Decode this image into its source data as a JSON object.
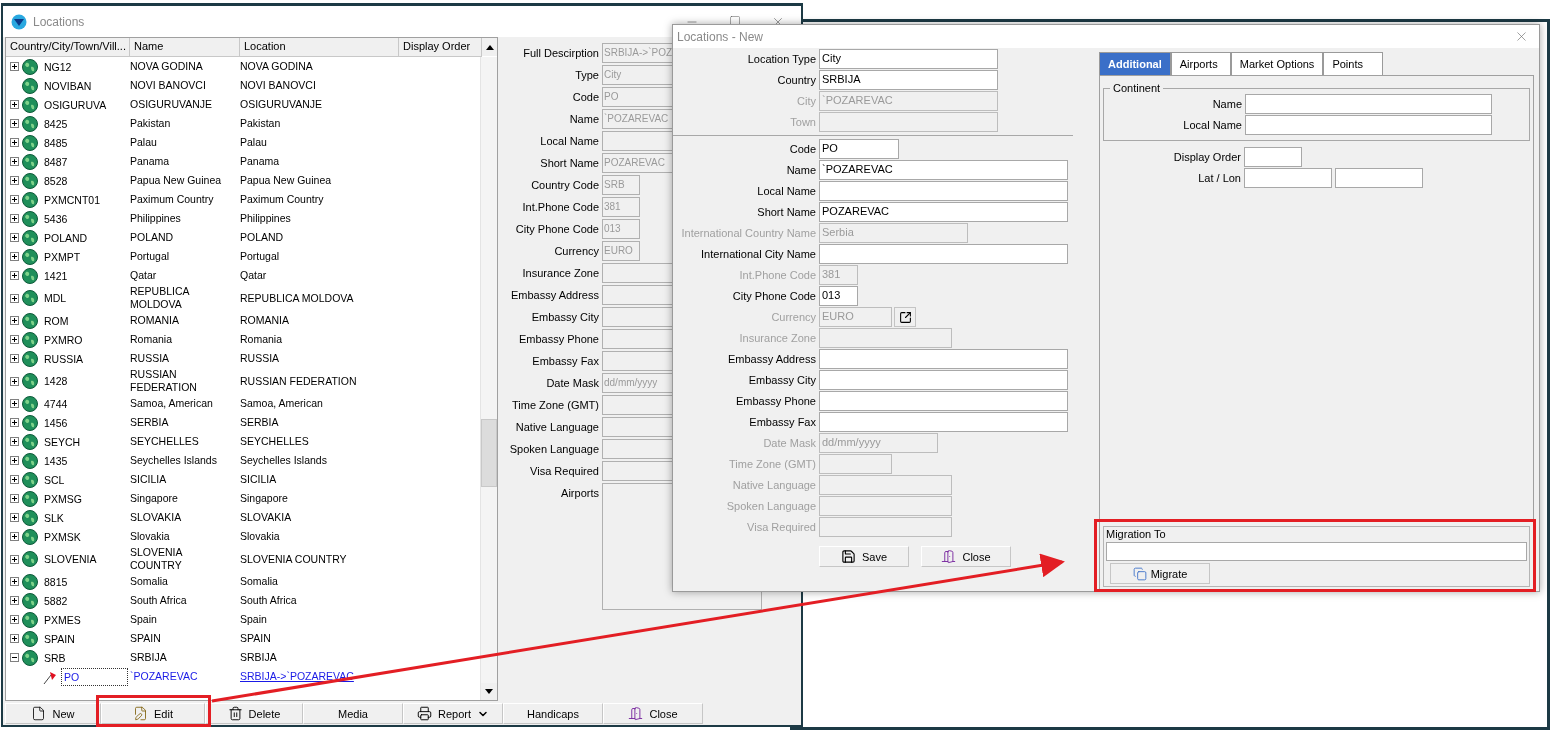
{
  "main_window": {
    "title": "Locations",
    "tree": {
      "columns": [
        "Country/City/Town/Vill...",
        "Name",
        "Location",
        "Display Order"
      ],
      "rows": [
        {
          "kind": "country",
          "code": "NG12",
          "name": "NOVA GODINA",
          "location": "NOVA GODINA",
          "expanded": false,
          "selected": false
        },
        {
          "kind": "country",
          "code": "NOVIBAN",
          "name": "NOVI BANOVCI",
          "location": "NOVI BANOVCI",
          "selected": false
        },
        {
          "kind": "country",
          "code": "OSIGURUVA",
          "name": "OSIGURUVANJE",
          "location": "OSIGURUVANJE",
          "expanded": false,
          "selected": false
        },
        {
          "kind": "country",
          "code": "8425",
          "name": "Pakistan",
          "location": "Pakistan",
          "expanded": false,
          "selected": false
        },
        {
          "kind": "country",
          "code": "8485",
          "name": "Palau",
          "location": "Palau",
          "expanded": false,
          "selected": false
        },
        {
          "kind": "country",
          "code": "8487",
          "name": "Panama",
          "location": "Panama",
          "expanded": false,
          "selected": false
        },
        {
          "kind": "country",
          "code": "8528",
          "name": "Papua New Guinea",
          "location": "Papua New Guinea",
          "expanded": false,
          "selected": false
        },
        {
          "kind": "country",
          "code": "PXMCNT01",
          "name": "Paximum Country",
          "location": "Paximum Country",
          "expanded": false,
          "selected": false
        },
        {
          "kind": "country",
          "code": "5436",
          "name": "Philippines",
          "location": "Philippines",
          "expanded": false,
          "selected": false
        },
        {
          "kind": "country",
          "code": "POLAND",
          "name": "POLAND",
          "location": "POLAND",
          "expanded": false,
          "selected": false
        },
        {
          "kind": "country",
          "code": "PXMPT",
          "name": "Portugal",
          "location": "Portugal",
          "expanded": false,
          "selected": false
        },
        {
          "kind": "country",
          "code": "1421",
          "name": "Qatar",
          "location": "Qatar",
          "expanded": false,
          "selected": false
        },
        {
          "kind": "country",
          "code": "MDL",
          "name": "REPUBLICA MOLDOVA",
          "location": "REPUBLICA MOLDOVA",
          "expanded": false,
          "selected": false
        },
        {
          "kind": "country",
          "code": "ROM",
          "name": "ROMANIA",
          "location": "ROMANIA",
          "expanded": false,
          "selected": false
        },
        {
          "kind": "country",
          "code": "PXMRO",
          "name": "Romania",
          "location": "Romania",
          "expanded": false,
          "selected": false
        },
        {
          "kind": "country",
          "code": "RUSSIA",
          "name": "RUSSIA",
          "location": "RUSSIA",
          "expanded": false,
          "selected": false
        },
        {
          "kind": "country",
          "code": "1428",
          "name": "RUSSIAN FEDERATION",
          "location": "RUSSIAN FEDERATION",
          "expanded": false,
          "selected": false
        },
        {
          "kind": "country",
          "code": "4744",
          "name": "Samoa, American",
          "location": "Samoa, American",
          "expanded": false,
          "selected": false
        },
        {
          "kind": "country",
          "code": "1456",
          "name": "SERBIA",
          "location": "SERBIA",
          "expanded": false,
          "selected": false
        },
        {
          "kind": "country",
          "code": "SEYCH",
          "name": "SEYCHELLES",
          "location": "SEYCHELLES",
          "expanded": false,
          "selected": false
        },
        {
          "kind": "country",
          "code": "1435",
          "name": "Seychelles Islands",
          "location": "Seychelles Islands",
          "expanded": false,
          "selected": false
        },
        {
          "kind": "country",
          "code": "SCL",
          "name": "SICILIA",
          "location": "SICILIA",
          "expanded": false,
          "selected": false
        },
        {
          "kind": "country",
          "code": "PXMSG",
          "name": "Singapore",
          "location": "Singapore",
          "expanded": false,
          "selected": false
        },
        {
          "kind": "country",
          "code": "SLK",
          "name": "SLOVAKIA",
          "location": "SLOVAKIA",
          "expanded": false,
          "selected": false
        },
        {
          "kind": "country",
          "code": "PXMSK",
          "name": "Slovakia",
          "location": "Slovakia",
          "expanded": false,
          "selected": false
        },
        {
          "kind": "country",
          "code": "SLOVENIA",
          "name": "SLOVENIA COUNTRY",
          "location": "SLOVENIA COUNTRY",
          "expanded": false,
          "selected": false
        },
        {
          "kind": "country",
          "code": "8815",
          "name": "Somalia",
          "location": "Somalia",
          "expanded": false,
          "selected": false
        },
        {
          "kind": "country",
          "code": "5882",
          "name": "South Africa",
          "location": "South Africa",
          "expanded": false,
          "selected": false
        },
        {
          "kind": "country",
          "code": "PXMES",
          "name": "Spain",
          "location": "Spain",
          "expanded": false,
          "selected": false
        },
        {
          "kind": "country",
          "code": "SPAIN",
          "name": "SPAIN",
          "location": "SPAIN",
          "expanded": false,
          "selected": false
        },
        {
          "kind": "country",
          "code": "SRB",
          "name": "SRBIJA",
          "location": "SRBIJA",
          "expanded": true,
          "selected": false,
          "children": [
            {
              "kind": "city",
              "code": "PO",
              "name": "`POZAREVAC",
              "location": "SRBIJA->`POZAREVAC",
              "selected": true
            }
          ]
        }
      ]
    },
    "details": {
      "fields": [
        {
          "kind": "long",
          "label": "Full Descirption",
          "value": "SRBIJA->`POZ"
        },
        {
          "kind": "long",
          "label": "Type",
          "value": "City"
        },
        {
          "kind": "long",
          "label": "Code",
          "value": "PO"
        },
        {
          "kind": "long",
          "label": "Name",
          "value": "`POZAREVAC"
        },
        {
          "kind": "long",
          "label": "Local Name"
        },
        {
          "kind": "long",
          "label": "Short Name",
          "value": "POZAREVAC"
        },
        {
          "kind": "short",
          "label": "Country Code",
          "value": "SRB"
        },
        {
          "kind": "short",
          "label": "Int.Phone Code",
          "value": "381"
        },
        {
          "kind": "short",
          "label": "City Phone Code",
          "value": "013"
        },
        {
          "kind": "short",
          "label": "Currency",
          "value": "EURO"
        },
        {
          "kind": "long",
          "label": "Insurance Zone"
        },
        {
          "kind": "long",
          "label": "Embassy Address"
        },
        {
          "kind": "long",
          "label": "Embassy City"
        },
        {
          "kind": "long",
          "label": "Embassy Phone"
        },
        {
          "kind": "long",
          "label": "Embassy Fax"
        },
        {
          "kind": "long",
          "label": "Date Mask",
          "value": "dd/mm/yyyy"
        },
        {
          "kind": "medium",
          "label": "Time Zone (GMT)"
        },
        {
          "kind": "long",
          "label": "Native Language"
        },
        {
          "kind": "long",
          "label": "Spoken Language"
        },
        {
          "kind": "long",
          "label": "Visa Required"
        },
        {
          "kind": "list",
          "label": "Airports"
        }
      ]
    },
    "buttons": [
      {
        "kind": "new",
        "label": "New"
      },
      {
        "kind": "edit",
        "label": "Edit"
      },
      {
        "kind": "delete",
        "label": "Delete"
      },
      {
        "kind": "plain",
        "label": "Media"
      },
      {
        "kind": "report",
        "label": "Report"
      },
      {
        "kind": "plain",
        "label": "Handicaps"
      },
      {
        "kind": "close",
        "label": "Close"
      }
    ]
  },
  "dialog": {
    "title": "Locations - New",
    "header_fields": [
      {
        "kind": "medium",
        "label": "Location Type",
        "value": "City",
        "disabled": false
      },
      {
        "kind": "medium",
        "label": "Country",
        "value": "SRBIJA",
        "disabled": false
      },
      {
        "kind": "medium",
        "label": "City",
        "value": "`POZAREVAC",
        "disabled": true
      },
      {
        "kind": "medium",
        "label": "Town",
        "disabled": true
      }
    ],
    "fields": [
      {
        "kind": "code",
        "label": "Code",
        "value": "PO",
        "disabled": false
      },
      {
        "kind": "long",
        "label": "Name",
        "value": "`POZAREVAC",
        "disabled": false
      },
      {
        "kind": "long",
        "label": "Local Name",
        "disabled": false
      },
      {
        "kind": "long",
        "label": "Short Name",
        "value": "POZAREVAC",
        "disabled": false
      },
      {
        "kind": "wide",
        "label": "International Country Name",
        "value": "Serbia",
        "disabled": true
      },
      {
        "kind": "long",
        "label": "International City Name",
        "disabled": false
      },
      {
        "kind": "tiny",
        "label": "Int.Phone Code",
        "value": "381",
        "disabled": true
      },
      {
        "kind": "tiny",
        "label": "City Phone Code",
        "value": "013",
        "disabled": false
      },
      {
        "kind": "lookup",
        "label": "Currency",
        "value": "EURO",
        "disabled": true
      },
      {
        "kind": "zone",
        "label": "Insurance Zone",
        "disabled": true
      },
      {
        "kind": "long",
        "label": "Embassy Address",
        "disabled": false
      },
      {
        "kind": "long",
        "label": "Embassy City",
        "disabled": false
      },
      {
        "kind": "long",
        "label": "Embassy Phone",
        "disabled": false
      },
      {
        "kind": "long",
        "label": "Embassy Fax",
        "disabled": false
      },
      {
        "kind": "date",
        "label": "Date Mask",
        "value": "dd/mm/yyyy",
        "disabled": true
      },
      {
        "kind": "short",
        "label": "Time Zone (GMT)",
        "disabled": true
      },
      {
        "kind": "zone",
        "label": "Native Language",
        "disabled": true
      },
      {
        "kind": "zone",
        "label": "Spoken Language",
        "disabled": true
      },
      {
        "kind": "zone",
        "label": "Visa Required",
        "disabled": true
      }
    ],
    "buttons": [
      {
        "kind": "save",
        "label": "Save"
      },
      {
        "kind": "close",
        "label": "Close"
      }
    ],
    "tabs": [
      {
        "label": "Additional",
        "selected": true
      },
      {
        "label": "Airports",
        "selected": false
      },
      {
        "label": "Market Options",
        "selected": false
      },
      {
        "label": "Points",
        "selected": false
      }
    ],
    "continent": {
      "title": "Continent",
      "fields": [
        {
          "label": "Name"
        },
        {
          "label": "Local Name"
        }
      ]
    },
    "display_order": {
      "label": "Display Order"
    },
    "lat_lon": {
      "label": "Lat / Lon"
    },
    "migration": {
      "title": "Migration To",
      "button": "Migrate"
    }
  }
}
